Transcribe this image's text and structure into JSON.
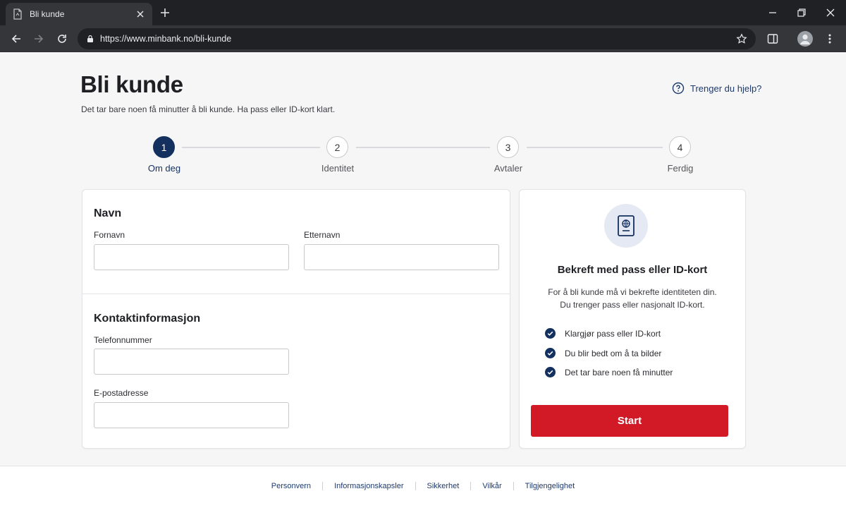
{
  "browser": {
    "tab_title": "Bli kunde",
    "url": "https://www.minbank.no/bli-kunde"
  },
  "header": {
    "title": "Bli kunde",
    "subtitle": "Det tar bare noen få minutter å bli kunde. Ha pass eller ID-kort klart.",
    "help_label": "Trenger du hjelp?"
  },
  "stepper": {
    "steps": [
      {
        "number": "1",
        "label": "Om deg",
        "active": true
      },
      {
        "number": "2",
        "label": "Identitet",
        "active": false
      },
      {
        "number": "3",
        "label": "Avtaler",
        "active": false
      },
      {
        "number": "4",
        "label": "Ferdig",
        "active": false
      }
    ]
  },
  "form": {
    "name_section": {
      "title": "Navn",
      "first_name_label": "Fornavn",
      "first_name_value": "",
      "last_name_label": "Etternavn",
      "last_name_value": ""
    },
    "contact_section": {
      "title": "Kontaktinformasjon",
      "phone_label": "Telefonnummer",
      "phone_value": "",
      "email_label": "E-postadresse",
      "email_value": ""
    }
  },
  "id_panel": {
    "icon": "passport-icon",
    "title": "Bekreft med pass eller ID-kort",
    "description_line1": "For å bli kunde må vi bekrefte identiteten din.",
    "description_line2": "Du trenger pass eller nasjonalt ID-kort.",
    "checklist": [
      "Klargjør pass eller ID-kort",
      "Du blir bedt om å ta bilder",
      "Det tar bare noen få minutter"
    ],
    "start_label": "Start"
  },
  "footer": {
    "links": [
      "Personvern",
      "Informasjonskapsler",
      "Sikkerhet",
      "Vilkår",
      "Tilgjengelighet"
    ]
  },
  "colors": {
    "brand_navy": "#13305f",
    "link_blue": "#1d3a6e",
    "start_red": "#d21a27",
    "page_bg": "#f6f6f7"
  }
}
